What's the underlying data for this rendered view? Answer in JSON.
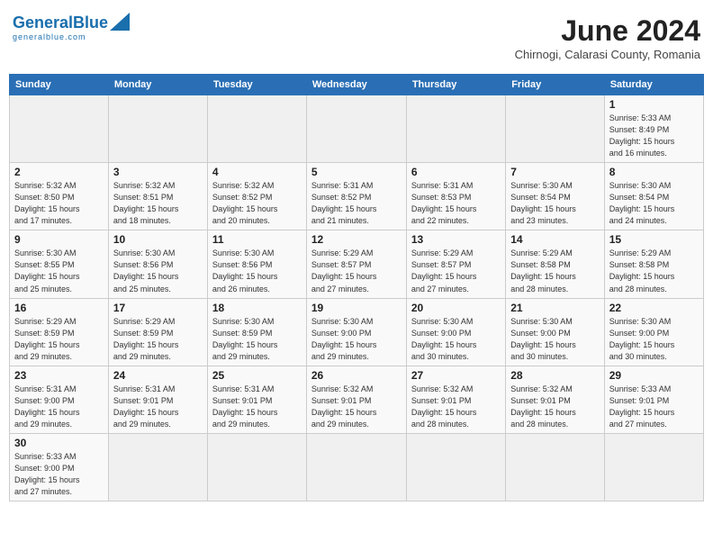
{
  "header": {
    "logo_general": "General",
    "logo_blue": "Blue",
    "logo_sub": "generalblue.com",
    "month_year": "June 2024",
    "location": "Chirnogi, Calarasi County, Romania"
  },
  "days_of_week": [
    "Sunday",
    "Monday",
    "Tuesday",
    "Wednesday",
    "Thursday",
    "Friday",
    "Saturday"
  ],
  "weeks": [
    [
      {
        "day": "",
        "info": ""
      },
      {
        "day": "",
        "info": ""
      },
      {
        "day": "",
        "info": ""
      },
      {
        "day": "",
        "info": ""
      },
      {
        "day": "",
        "info": ""
      },
      {
        "day": "",
        "info": ""
      },
      {
        "day": "1",
        "info": "Sunrise: 5:33 AM\nSunset: 8:49 PM\nDaylight: 15 hours\nand 16 minutes."
      }
    ],
    [
      {
        "day": "2",
        "info": "Sunrise: 5:32 AM\nSunset: 8:50 PM\nDaylight: 15 hours\nand 17 minutes."
      },
      {
        "day": "3",
        "info": "Sunrise: 5:32 AM\nSunset: 8:51 PM\nDaylight: 15 hours\nand 18 minutes."
      },
      {
        "day": "4",
        "info": "Sunrise: 5:32 AM\nSunset: 8:52 PM\nDaylight: 15 hours\nand 20 minutes."
      },
      {
        "day": "5",
        "info": "Sunrise: 5:31 AM\nSunset: 8:52 PM\nDaylight: 15 hours\nand 21 minutes."
      },
      {
        "day": "6",
        "info": "Sunrise: 5:31 AM\nSunset: 8:53 PM\nDaylight: 15 hours\nand 22 minutes."
      },
      {
        "day": "7",
        "info": "Sunrise: 5:30 AM\nSunset: 8:54 PM\nDaylight: 15 hours\nand 23 minutes."
      },
      {
        "day": "8",
        "info": "Sunrise: 5:30 AM\nSunset: 8:54 PM\nDaylight: 15 hours\nand 24 minutes."
      }
    ],
    [
      {
        "day": "9",
        "info": "Sunrise: 5:30 AM\nSunset: 8:55 PM\nDaylight: 15 hours\nand 25 minutes."
      },
      {
        "day": "10",
        "info": "Sunrise: 5:30 AM\nSunset: 8:56 PM\nDaylight: 15 hours\nand 25 minutes."
      },
      {
        "day": "11",
        "info": "Sunrise: 5:30 AM\nSunset: 8:56 PM\nDaylight: 15 hours\nand 26 minutes."
      },
      {
        "day": "12",
        "info": "Sunrise: 5:29 AM\nSunset: 8:57 PM\nDaylight: 15 hours\nand 27 minutes."
      },
      {
        "day": "13",
        "info": "Sunrise: 5:29 AM\nSunset: 8:57 PM\nDaylight: 15 hours\nand 27 minutes."
      },
      {
        "day": "14",
        "info": "Sunrise: 5:29 AM\nSunset: 8:58 PM\nDaylight: 15 hours\nand 28 minutes."
      },
      {
        "day": "15",
        "info": "Sunrise: 5:29 AM\nSunset: 8:58 PM\nDaylight: 15 hours\nand 28 minutes."
      }
    ],
    [
      {
        "day": "16",
        "info": "Sunrise: 5:29 AM\nSunset: 8:59 PM\nDaylight: 15 hours\nand 29 minutes."
      },
      {
        "day": "17",
        "info": "Sunrise: 5:29 AM\nSunset: 8:59 PM\nDaylight: 15 hours\nand 29 minutes."
      },
      {
        "day": "18",
        "info": "Sunrise: 5:30 AM\nSunset: 8:59 PM\nDaylight: 15 hours\nand 29 minutes."
      },
      {
        "day": "19",
        "info": "Sunrise: 5:30 AM\nSunset: 9:00 PM\nDaylight: 15 hours\nand 29 minutes."
      },
      {
        "day": "20",
        "info": "Sunrise: 5:30 AM\nSunset: 9:00 PM\nDaylight: 15 hours\nand 30 minutes."
      },
      {
        "day": "21",
        "info": "Sunrise: 5:30 AM\nSunset: 9:00 PM\nDaylight: 15 hours\nand 30 minutes."
      },
      {
        "day": "22",
        "info": "Sunrise: 5:30 AM\nSunset: 9:00 PM\nDaylight: 15 hours\nand 30 minutes."
      }
    ],
    [
      {
        "day": "23",
        "info": "Sunrise: 5:31 AM\nSunset: 9:00 PM\nDaylight: 15 hours\nand 29 minutes."
      },
      {
        "day": "24",
        "info": "Sunrise: 5:31 AM\nSunset: 9:01 PM\nDaylight: 15 hours\nand 29 minutes."
      },
      {
        "day": "25",
        "info": "Sunrise: 5:31 AM\nSunset: 9:01 PM\nDaylight: 15 hours\nand 29 minutes."
      },
      {
        "day": "26",
        "info": "Sunrise: 5:32 AM\nSunset: 9:01 PM\nDaylight: 15 hours\nand 29 minutes."
      },
      {
        "day": "27",
        "info": "Sunrise: 5:32 AM\nSunset: 9:01 PM\nDaylight: 15 hours\nand 28 minutes."
      },
      {
        "day": "28",
        "info": "Sunrise: 5:32 AM\nSunset: 9:01 PM\nDaylight: 15 hours\nand 28 minutes."
      },
      {
        "day": "29",
        "info": "Sunrise: 5:33 AM\nSunset: 9:01 PM\nDaylight: 15 hours\nand 27 minutes."
      }
    ],
    [
      {
        "day": "30",
        "info": "Sunrise: 5:33 AM\nSunset: 9:00 PM\nDaylight: 15 hours\nand 27 minutes."
      },
      {
        "day": "",
        "info": ""
      },
      {
        "day": "",
        "info": ""
      },
      {
        "day": "",
        "info": ""
      },
      {
        "day": "",
        "info": ""
      },
      {
        "day": "",
        "info": ""
      },
      {
        "day": "",
        "info": ""
      }
    ]
  ]
}
